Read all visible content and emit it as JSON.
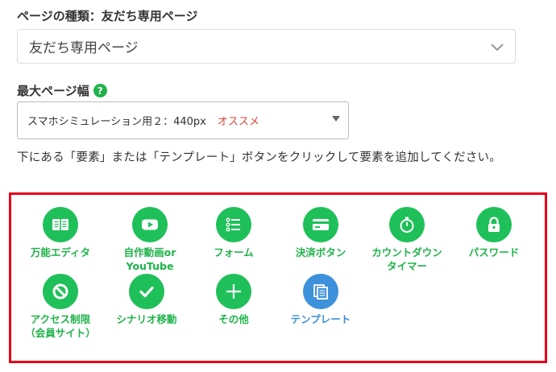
{
  "page_type": {
    "label": "ページの種類：友だち専用ページ",
    "selected": "友だち専用ページ"
  },
  "max_width": {
    "label": "最大ページ幅",
    "help": "?",
    "selected": "スマホシミュレーション用２：440px",
    "recommend": "オススメ"
  },
  "instruction": "下にある「要素」または「テンプレート」ボタンをクリックして要素を追加してください。",
  "elements": {
    "universal_editor": "万能エディタ",
    "video_line1": "自作動画or",
    "video_line2": "YouTube",
    "form": "フォーム",
    "payment": "決済ボタン",
    "countdown_line1": "カウントダウン",
    "countdown_line2": "タイマー",
    "password": "パスワード",
    "access_line1": "アクセス制限",
    "access_line2": "（会員サイト）",
    "scenario": "シナリオ移動",
    "other": "その他",
    "template": "テンプレート"
  },
  "colors": {
    "accent_green": "#1fc05a",
    "template_blue": "#3d91db",
    "panel_border": "#e3001b",
    "recommend_red": "#d9463a"
  },
  "icons": [
    "book-icon",
    "play-icon",
    "list-icon",
    "card-icon",
    "stopwatch-icon",
    "lock-icon",
    "ban-icon",
    "check-icon",
    "plus-icon",
    "copy-icon"
  ]
}
